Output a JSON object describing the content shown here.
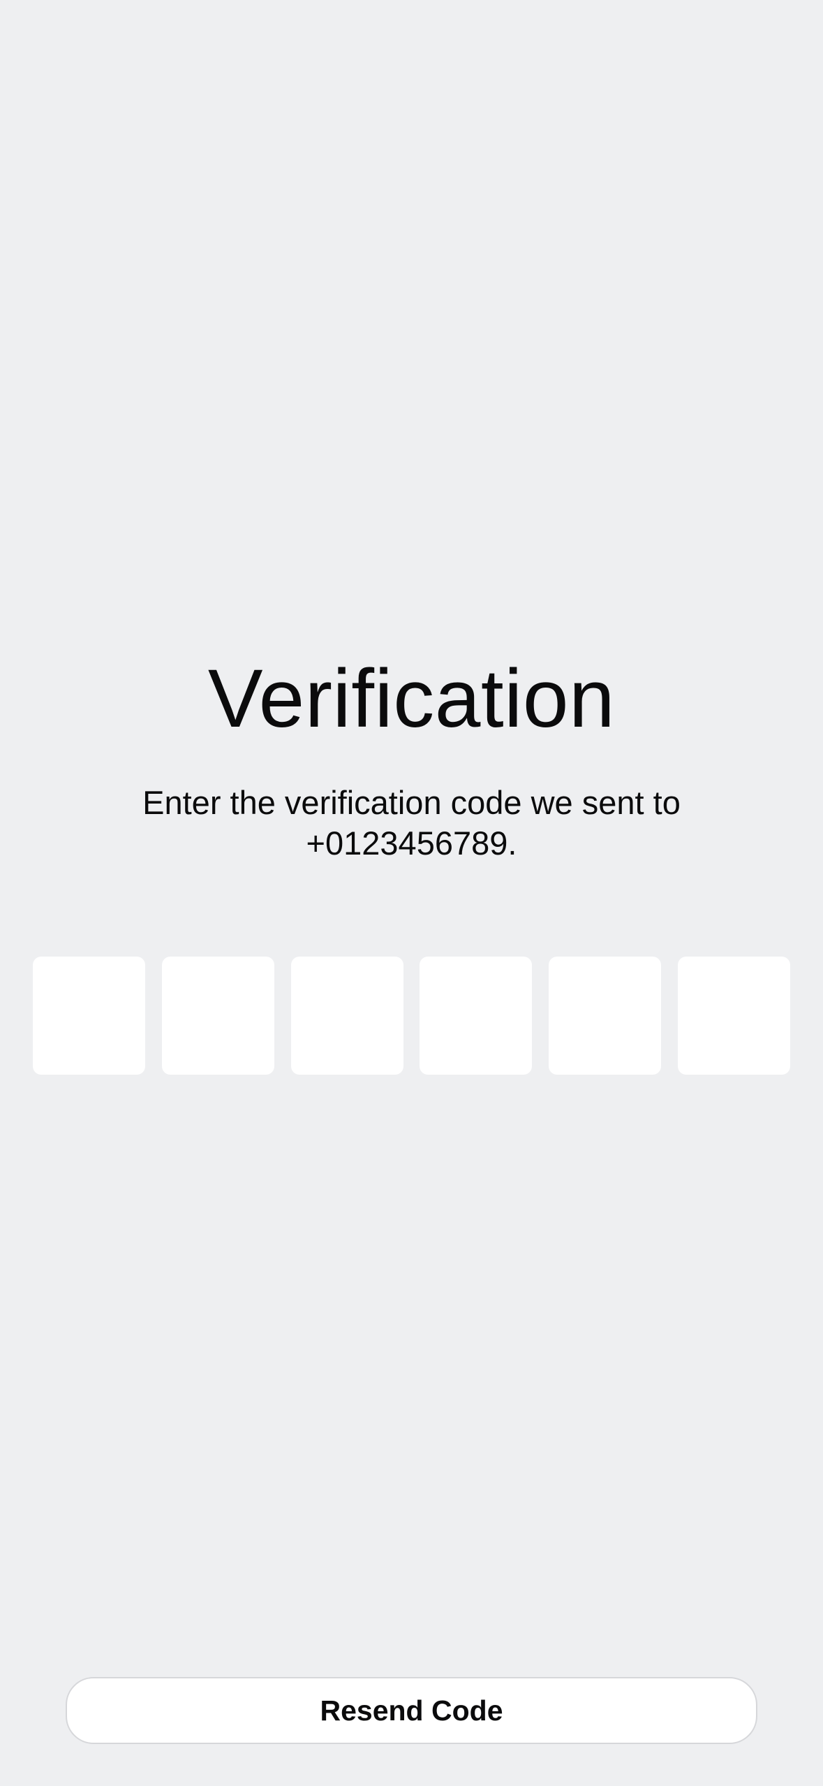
{
  "screen": {
    "title": "Verification",
    "subtitle_line1": "Enter the verification code we sent to",
    "subtitle_line2": "+0123456789."
  },
  "code": {
    "digits": [
      "",
      "",
      "",
      "",
      "",
      ""
    ]
  },
  "actions": {
    "resend_label": "Resend Code"
  },
  "colors": {
    "background": "#eeeff1",
    "box": "#ffffff",
    "text": "#0b0b0c",
    "button_border": "#d6d7da"
  }
}
